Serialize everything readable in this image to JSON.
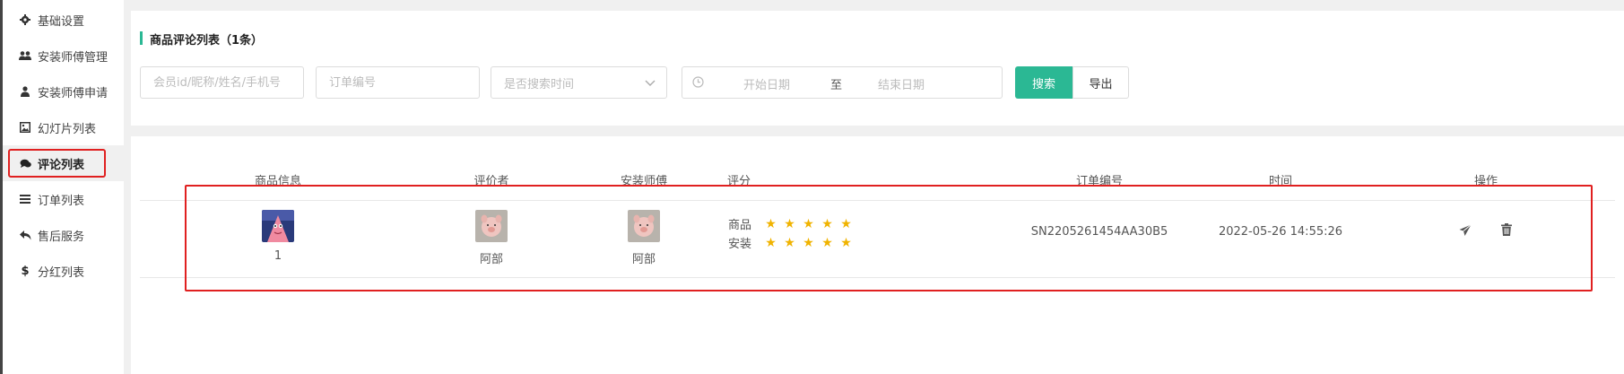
{
  "sidebar": {
    "items": [
      {
        "label": "基础设置",
        "icon": "gear-icon"
      },
      {
        "label": "安装师傅管理",
        "icon": "users-icon"
      },
      {
        "label": "安装师傅申请",
        "icon": "user-icon"
      },
      {
        "label": "幻灯片列表",
        "icon": "image-icon"
      },
      {
        "label": "评论列表",
        "icon": "comments-icon",
        "active": true
      },
      {
        "label": "订单列表",
        "icon": "list-icon"
      },
      {
        "label": "售后服务",
        "icon": "reply-icon"
      },
      {
        "label": "分红列表",
        "icon": "dollar-icon"
      }
    ]
  },
  "header": {
    "title": "商品评论列表（1条）"
  },
  "filters": {
    "member_placeholder": "会员id/昵称/姓名/手机号",
    "order_placeholder": "订单编号",
    "time_select": "是否搜索时间",
    "start_date": "开始日期",
    "range_sep": "至",
    "end_date": "结束日期",
    "search_label": "搜索",
    "export_label": "导出"
  },
  "table": {
    "columns": [
      "商品信息",
      "评价者",
      "安装师傅",
      "评分",
      "订单编号",
      "时间",
      "操作"
    ],
    "rows": [
      {
        "product_name": "1",
        "reviewer": "阿部",
        "installer": "阿部",
        "rating_product_label": "商品",
        "rating_install_label": "安装",
        "rating_product": 5,
        "rating_install": 5,
        "order_no": "SN2205261454AA30B5",
        "time": "2022-05-26 14:55:26"
      }
    ]
  },
  "colors": {
    "accent": "#2bb894",
    "star": "#f0b300",
    "highlight": "#e02020"
  }
}
